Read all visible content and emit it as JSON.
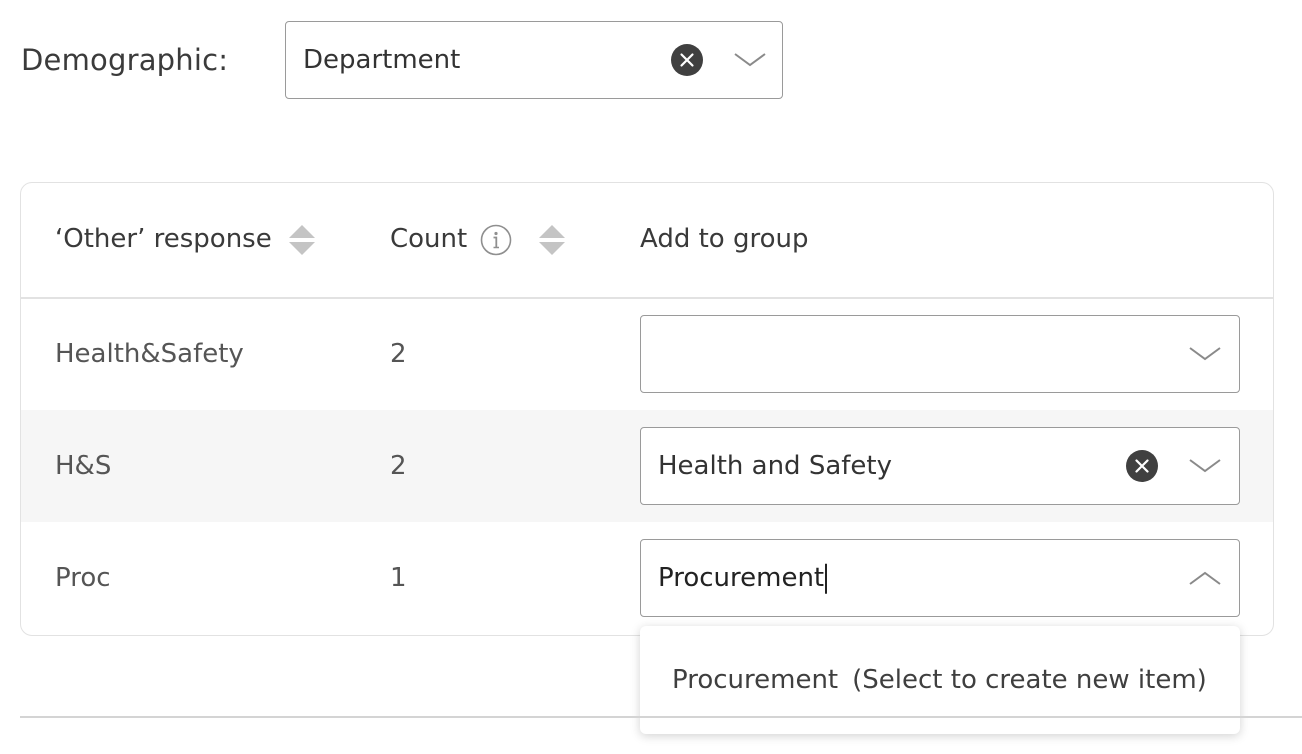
{
  "demographic": {
    "label": "Demographic:",
    "selected_value": "Department",
    "clear_icon": "clear-circle-x-icon",
    "toggle_icon": "chevron-down-icon"
  },
  "table": {
    "columns": [
      {
        "label": "‘Other’ response",
        "sortable": true,
        "sort_icon": "sort-icon"
      },
      {
        "label": "Count",
        "sortable": true,
        "info_icon": "info-icon",
        "sort_icon": "sort-icon"
      },
      {
        "label": "Add to group",
        "sortable": false
      }
    ],
    "rows": [
      {
        "response": "Health&Safety",
        "count": "2",
        "group": "",
        "clearable": false,
        "open": false
      },
      {
        "response": "H&S",
        "count": "2",
        "group": "Health and Safety",
        "clearable": true,
        "open": false
      },
      {
        "response": "Proc",
        "count": "1",
        "group": "Procurement",
        "clearable": false,
        "open": true
      }
    ]
  },
  "dropdown": {
    "option_value": "Procurement",
    "option_hint": "(Select to create new item)"
  },
  "colors": {
    "text": "#3d3d3d",
    "border": "#9a9a9a",
    "row_alt": "#f6f6f6",
    "clear_icon": "#404040",
    "sort_icon": "#c4c4c4"
  }
}
